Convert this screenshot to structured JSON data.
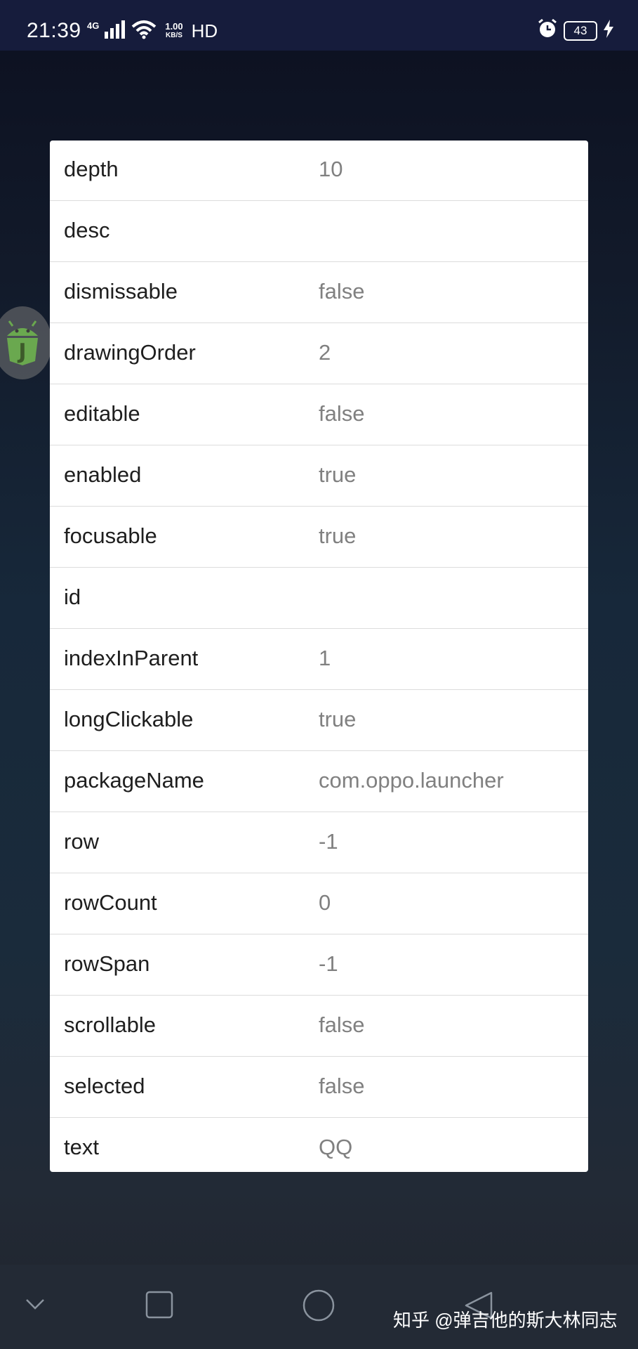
{
  "status_bar": {
    "time": "21:39",
    "network_type": "4G",
    "speed_value": "1.00",
    "speed_unit": "KB/S",
    "hd_label": "HD",
    "battery_level": "43"
  },
  "properties": [
    {
      "name": "depth",
      "value": "10"
    },
    {
      "name": "desc",
      "value": ""
    },
    {
      "name": "dismissable",
      "value": "false"
    },
    {
      "name": "drawingOrder",
      "value": "2"
    },
    {
      "name": "editable",
      "value": "false"
    },
    {
      "name": "enabled",
      "value": "true"
    },
    {
      "name": "focusable",
      "value": "true"
    },
    {
      "name": "id",
      "value": ""
    },
    {
      "name": "indexInParent",
      "value": "1"
    },
    {
      "name": "longClickable",
      "value": "true"
    },
    {
      "name": "packageName",
      "value": "com.oppo.launcher"
    },
    {
      "name": "row",
      "value": "-1"
    },
    {
      "name": "rowCount",
      "value": "0"
    },
    {
      "name": "rowSpan",
      "value": "-1"
    },
    {
      "name": "scrollable",
      "value": "false"
    },
    {
      "name": "selected",
      "value": "false"
    },
    {
      "name": "text",
      "value": "QQ"
    }
  ],
  "watermark": "知乎 @弹吉他的斯大林同志",
  "icons": {
    "signal": "signal-bars-icon",
    "wifi": "wifi-icon",
    "alarm": "alarm-clock-icon",
    "charging": "lightning-bolt-icon",
    "floating": "android-js-icon",
    "nav_collapse": "chevron-down-icon",
    "nav_recents": "square-icon",
    "nav_home": "circle-icon",
    "nav_back": "triangle-back-icon"
  },
  "colors": {
    "status_bar_bg": "#161c3c",
    "card_bg": "#ffffff",
    "name_text": "#1e1e1e",
    "value_text": "#808080",
    "nav_bar_bg": "#232a35",
    "float_icon": "#6aa84f"
  }
}
